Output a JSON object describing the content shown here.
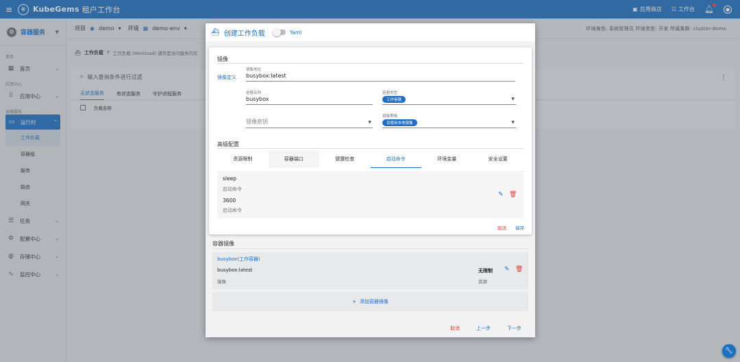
{
  "topbar": {
    "brand": "KubeGems",
    "subtitle": "租户工作台",
    "app_store": "应用商店",
    "workbench": "工作台"
  },
  "sidebar": {
    "header": "容器服务",
    "sections": {
      "home": "首页",
      "app_center": "应用中心",
      "container": "容器服务"
    },
    "items": {
      "home": "首页",
      "app_center": "应用中心",
      "runtime": "运行时",
      "tasks": "任务",
      "config": "配置中心",
      "storage": "存储中心",
      "monitor": "监控中心"
    },
    "subs": [
      "工作负载",
      "容器组",
      "服务",
      "路由",
      "网关"
    ]
  },
  "crumb": {
    "project_label": "项目",
    "project": "demo",
    "env_label": "环境",
    "env": "demo-env",
    "env_info": "环境角色: 系统管理员   环境类型: 开发   所属集群: cluster-demo"
  },
  "page": {
    "title": "工作负载",
    "desc": "工作负载 (Workload) 通常是访问服务的实",
    "search_placeholder": "输入查询条件进行过滤",
    "tabs": [
      "无状态服务",
      "有状态服务",
      "守护进程服务"
    ],
    "col_name": "负载名称"
  },
  "modal": {
    "title": "创建工作负载",
    "yaml_label": "Yaml",
    "image_section": "镜像",
    "image_def": "镜像定义",
    "image_addr_label": "镜像地址",
    "image_addr": "busybox:latest",
    "container_name_label": "容器名称",
    "container_name": "busybox",
    "container_type_label": "容器类型",
    "container_type": "工作容器",
    "image_secret_placeholder": "镜像密钥",
    "pull_policy_label": "镜像策略",
    "pull_policy": "仅使用本地镜像",
    "advanced": "高级配置",
    "adv_tabs": [
      "资源限制",
      "容器端口",
      "健康检查",
      "启动命令",
      "环境变量",
      "安全设置"
    ],
    "cmd1": "sleep",
    "cmd1_hint": "启动命令",
    "cmd2": "3600",
    "cmd2_hint": "启动命令",
    "cancel": "取消",
    "save": "保存",
    "container_images": "容器镜像",
    "img_name": "busybox(工作容器)",
    "img_value": "busybox:latest",
    "img_value_label": "镜像",
    "limit_value": "无限制",
    "limit_label": "资源",
    "add_image": "添加容器镜像",
    "footer_cancel": "取消",
    "footer_prev": "上一步",
    "footer_next": "下一步"
  }
}
